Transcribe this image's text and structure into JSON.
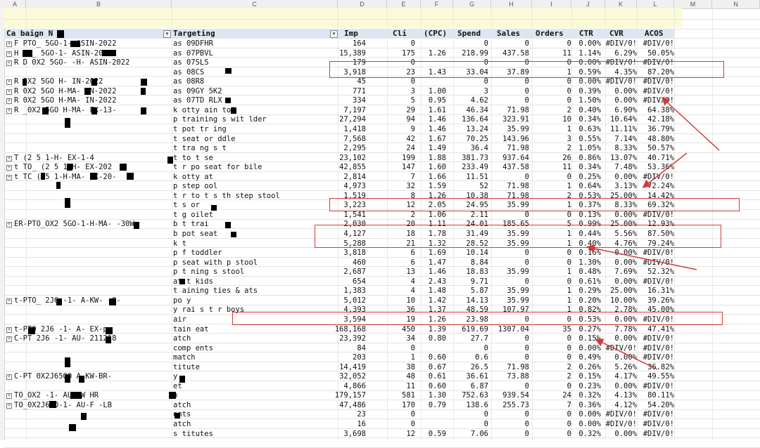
{
  "column_letters": [
    "A",
    "B",
    "C",
    "D",
    "E",
    "F",
    "G",
    "H",
    "I",
    "J",
    "K",
    "L",
    "M",
    "N"
  ],
  "headers": [
    "Ca   baign N",
    "Targeting",
    "Imp",
    "Cli",
    "(CPC)",
    "Spend",
    "Sales",
    "Orders",
    "CTR",
    "CVR",
    "ACOS"
  ],
  "rows": [
    {
      "campaign": "F   PTO_    5GO-1-     ASIN-2022",
      "targeting": "as     09DFHR",
      "imp": "164",
      "cli": "0",
      "cpc": "",
      "spend": "0",
      "sales": "0",
      "orders": "0",
      "ctr": "0.00%",
      "cvr": "#DIV/0!",
      "acos": "#DIV/0!"
    },
    {
      "campaign": "H    TO_    5GO-1-     ASIN-2022",
      "targeting": "as     07PBVL",
      "imp": "15,389",
      "cli": "175",
      "cpc": "1.26",
      "spend": "218.99",
      "sales": "437.58",
      "orders": "11",
      "ctr": "1.14%",
      "cvr": "6.29%",
      "acos": "50.05%"
    },
    {
      "campaign": "R    D  0X2  5GO-   -H-     ASIN-2022",
      "targeting": "as     07SLS",
      "imp": "179",
      "cli": "0",
      "cpc": "",
      "spend": "0",
      "sales": "0",
      "orders": "0",
      "ctr": "0.00%",
      "cvr": "#DIV/0!",
      "acos": "#DIV/0!"
    },
    {
      "campaign": "",
      "targeting": "as     08CS",
      "imp": "3,918",
      "cli": "23",
      "cpc": "1.43",
      "spend": "33.04",
      "sales": "37.89",
      "orders": "1",
      "ctr": "0.59%",
      "cvr": "4.35%",
      "acos": "87.20%"
    },
    {
      "campaign": "R    0X2  5GO   H-    IN-2022",
      "targeting": "as     08R8",
      "imp": "45",
      "cli": "0",
      "cpc": "",
      "spend": "0",
      "sales": "0",
      "orders": "0",
      "ctr": "0.00%",
      "cvr": "#DIV/0!",
      "acos": "#DIV/0!"
    },
    {
      "campaign": "R    0X2  5GO   H-MA-   IN-2022",
      "targeting": "as     09GY  5K2",
      "imp": "771",
      "cli": "3",
      "cpc": "1.00",
      "spend": "3",
      "sales": "0",
      "orders": "0",
      "ctr": "0.39%",
      "cvr": "0.00%",
      "acos": "#DIV/0!"
    },
    {
      "campaign": "R    0X2  5GO   H-MA-   IN-2022",
      "targeting": "as     07TD  RLX",
      "imp": "334",
      "cli": "5",
      "cpc": "0.95",
      "spend": "4.62",
      "sales": "0",
      "orders": "0",
      "ctr": "1.50%",
      "cvr": "0.00%",
      "acos": "#DIV/0!"
    },
    {
      "campaign": "R    _0X2  5GO   H-MA-   EX-13-",
      "targeting": "k   otty   ain   toi  ",
      "imp": "7,197",
      "cli": "29",
      "cpc": "1.61",
      "spend": "46.34",
      "sales": "71.98",
      "orders": "2",
      "ctr": "0.40%",
      "cvr": "6.90%",
      "acos": "64.38%"
    },
    {
      "campaign": "",
      "targeting": "p   training s   wit    lder",
      "imp": "27,294",
      "cli": "94",
      "cpc": "1.46",
      "spend": "136.64",
      "sales": "323.91",
      "orders": "10",
      "ctr": "0.34%",
      "cvr": "10.64%",
      "acos": "42.18%"
    },
    {
      "campaign": "",
      "targeting": "t    pot   tr  ing",
      "imp": "1,418",
      "cli": "9",
      "cpc": "1.46",
      "spend": "13.24",
      "sales": "35.99",
      "orders": "1",
      "ctr": "0.63%",
      "cvr": "11.11%",
      "acos": "36.79%"
    },
    {
      "campaign": "",
      "targeting": "t    seat   or   ddle",
      "imp": "7,568",
      "cli": "42",
      "cpc": "1.67",
      "spend": "70.25",
      "sales": "143.96",
      "orders": "3",
      "ctr": "0.55%",
      "cvr": "7.14%",
      "acos": "48.80%"
    },
    {
      "campaign": "",
      "targeting": "t    tra   ng s   t",
      "imp": "2,295",
      "cli": "24",
      "cpc": "1.49",
      "spend": "36.4",
      "sales": "71.98",
      "orders": "2",
      "ctr": "1.05%",
      "cvr": "8.33%",
      "acos": "50.57%"
    },
    {
      "campaign": "    T  (2  5   1-H-    EX-1-4",
      "targeting": "t    to   t se",
      "imp": "23,102",
      "cli": "199",
      "cpc": "1.88",
      "spend": "381.73",
      "sales": "937.64",
      "orders": "26",
      "ctr": "0.86%",
      "cvr": "13.07%",
      "acos": "40.71%"
    },
    {
      "campaign": "   t  TO_  (2  5   1-H-    EX-202",
      "targeting": "t   r po   seat  for  bile",
      "imp": "42,855",
      "cli": "147",
      "cpc": "1.60",
      "spend": "233.49",
      "sales": "437.58",
      "orders": "11",
      "ctr": "0.34%",
      "cvr": "7.48%",
      "acos": "53.36%"
    },
    {
      "campaign": "    t  TC   (  5   1-H-MA-   EX-20-",
      "targeting": "k   otty   at",
      "imp": "2,814",
      "cli": "7",
      "cpc": "1.66",
      "spend": "11.51",
      "sales": "0",
      "orders": "0",
      "ctr": "0.25%",
      "cvr": "0.00%",
      "acos": "#DIV/0!"
    },
    {
      "campaign": "",
      "targeting": "p    step   ool",
      "imp": "4,973",
      "cli": "32",
      "cpc": "1.59",
      "spend": "52",
      "sales": "71.98",
      "orders": "1",
      "ctr": "0.64%",
      "cvr": "3.13%",
      "acos": "72.24%"
    },
    {
      "campaign": "",
      "targeting": "t    r to   t s   th step stool",
      "imp": "1,519",
      "cli": "8",
      "cpc": "1.26",
      "spend": "10.38",
      "sales": "71.98",
      "orders": "2",
      "ctr": "0.53%",
      "cvr": "25.00%",
      "acos": "14.42%"
    },
    {
      "campaign": "",
      "targeting": "t   s    or  ",
      "imp": "3,223",
      "cli": "12",
      "cpc": "2.05",
      "spend": "24.95",
      "sales": "35.99",
      "orders": "1",
      "ctr": "0.37%",
      "cvr": "8.33%",
      "acos": "69.32%"
    },
    {
      "campaign": "",
      "targeting": "t    g  oilet",
      "imp": "1,541",
      "cli": "2",
      "cpc": "1.06",
      "spend": "2.11",
      "sales": "0",
      "orders": "0",
      "ctr": "0.13%",
      "cvr": "0.00%",
      "acos": "#DIV/0!"
    },
    {
      "campaign": "   ER-PTO_OX2  5GO-1-H-MA-    -30W",
      "targeting": "b    t  trai  ",
      "imp": "2,030",
      "cli": "20",
      "cpc": "1.11",
      "spend": "24.01",
      "sales": "185.65",
      "orders": "5",
      "ctr": "0.99%",
      "cvr": "25.00%",
      "acos": "12.93%"
    },
    {
      "campaign": "",
      "targeting": "b   pot   seat",
      "imp": "4,127",
      "cli": "18",
      "cpc": "1.78",
      "spend": "31.49",
      "sales": "35.99",
      "orders": "1",
      "ctr": "0.44%",
      "cvr": "5.56%",
      "acos": "87.50%"
    },
    {
      "campaign": "",
      "targeting": "k    t",
      "imp": "5,288",
      "cli": "21",
      "cpc": "1.32",
      "spend": "28.52",
      "sales": "35.99",
      "orders": "1",
      "ctr": "0.40%",
      "cvr": "4.76%",
      "acos": "79.24%"
    },
    {
      "campaign": "",
      "targeting": "p    f    toddler",
      "imp": "3,818",
      "cli": "6",
      "cpc": "1.69",
      "spend": "10.14",
      "sales": "0",
      "orders": "0",
      "ctr": "0.16%",
      "cvr": "0.00%",
      "acos": "#DIV/0!"
    },
    {
      "campaign": "",
      "targeting": "p    seat with   p stool",
      "imp": "460",
      "cli": "6",
      "cpc": "1.47",
      "spend": "8.84",
      "sales": "0",
      "orders": "0",
      "ctr": "1.30%",
      "cvr": "0.00%",
      "acos": "#DIV/0!"
    },
    {
      "campaign": "",
      "targeting": "p   t   ning s    stool",
      "imp": "2,687",
      "cli": "13",
      "cpc": "1.46",
      "spend": "18.83",
      "sales": "35.99",
      "orders": "1",
      "ctr": "0.48%",
      "cvr": "7.69%",
      "acos": "52.32%"
    },
    {
      "campaign": "",
      "targeting": "    at   t kids",
      "imp": "654",
      "cli": "4",
      "cpc": "2.43",
      "spend": "9.71",
      "sales": "0",
      "orders": "0",
      "ctr": "0.61%",
      "cvr": "0.00%",
      "acos": "#DIV/0!"
    },
    {
      "campaign": "",
      "targeting": "   t   aining   ties &   ats",
      "imp": "1,383",
      "cli": "4",
      "cpc": "1.48",
      "spend": "5.87",
      "sales": "35.99",
      "orders": "1",
      "ctr": "0.29%",
      "cvr": "25.00%",
      "acos": "16.31%"
    },
    {
      "campaign": "   t-PTO_   2J6    -1-   A-KW-   -8-",
      "targeting": "    po   y",
      "imp": "5,012",
      "cli": "10",
      "cpc": "1.42",
      "spend": "14.13",
      "sales": "35.99",
      "orders": "1",
      "ctr": "0.20%",
      "cvr": "10.00%",
      "acos": "39.26%"
    },
    {
      "campaign": "",
      "targeting": "    y  rai   s    t   r boys",
      "imp": "4,393",
      "cli": "36",
      "cpc": "1.37",
      "spend": "48.59",
      "sales": "107.97",
      "orders": "1",
      "ctr": "0.82%",
      "cvr": "2.78%",
      "acos": "45.00%"
    },
    {
      "campaign": "",
      "targeting": "         air",
      "imp": "3,594",
      "cli": "19",
      "cpc": "1.26",
      "spend": "23.98",
      "sales": "0",
      "orders": "0",
      "ctr": "0.53%",
      "cvr": "0.00%",
      "acos": "#DIV/0!"
    },
    {
      "campaign": "   t-PTO   2J6    -1-   A-    EX-po",
      "targeting": "       tain   eat",
      "imp": "168,168",
      "cli": "450",
      "cpc": "1.39",
      "spend": "619.69",
      "sales": "1307.04",
      "orders": "35",
      "ctr": "0.27%",
      "cvr": "7.78%",
      "acos": "47.41%"
    },
    {
      "campaign": "  C-PT    2J6    -1-   AU-   211218",
      "targeting": "     atch",
      "imp": "23,392",
      "cli": "34",
      "cpc": "0.80",
      "spend": "27.7",
      "sales": "0",
      "orders": "0",
      "ctr": "0.15%",
      "cvr": "0.00%",
      "acos": "#DIV/0!"
    },
    {
      "campaign": "",
      "targeting": "comp    ents",
      "imp": "84",
      "cli": "0",
      "cpc": "",
      "spend": "0",
      "sales": "0",
      "orders": "0",
      "ctr": "0.00%",
      "cvr": "#DIV/0!",
      "acos": "#DIV/0!"
    },
    {
      "campaign": "",
      "targeting": "     match",
      "imp": "203",
      "cli": "1",
      "cpc": "0.60",
      "spend": "0.6",
      "sales": "0",
      "orders": "0",
      "ctr": "0.49%",
      "cvr": "0.00%",
      "acos": "#DIV/0!"
    },
    {
      "campaign": "",
      "targeting": "   titute",
      "imp": "14,419",
      "cli": "38",
      "cpc": "0.67",
      "spend": "26.5",
      "sales": "71.98",
      "orders": "2",
      "ctr": "0.26%",
      "cvr": "5.26%",
      "acos": "36.82%"
    },
    {
      "campaign": "  C-PT   0X2J65GO     A-KW-BR-",
      "targeting": "     y",
      "imp": "32,052",
      "cli": "48",
      "cpc": "0.61",
      "spend": "36.61",
      "sales": "73.88",
      "orders": "2",
      "ctr": "0.15%",
      "cvr": "4.17%",
      "acos": "49.55%"
    },
    {
      "campaign": "",
      "targeting": "    et  ",
      "imp": "4,866",
      "cli": "11",
      "cpc": "0.60",
      "spend": "6.87",
      "sales": "0",
      "orders": "0",
      "ctr": "0.23%",
      "cvr": "0.00%",
      "acos": "#DIV/0!"
    },
    {
      "campaign": "     TO_OX2    -1-   AU-KW   HR",
      "targeting": "     h",
      "imp": "179,157",
      "cli": "581",
      "cpc": "1.30",
      "spend": "752.63",
      "sales": "939.54",
      "orders": "24",
      "ctr": "0.32%",
      "cvr": "4.13%",
      "acos": "80.11%"
    },
    {
      "campaign": "    TO_0X2J6GO-1-   AU-F   -LB",
      "targeting": "     atch",
      "imp": "47,486",
      "cli": "170",
      "cpc": "0.79",
      "spend": "138.6",
      "sales": "255.73",
      "orders": "7",
      "ctr": "0.36%",
      "cvr": "4.12%",
      "acos": "54.20%"
    },
    {
      "campaign": "",
      "targeting": "    ents",
      "imp": "23",
      "cli": "0",
      "cpc": "",
      "spend": "0",
      "sales": "0",
      "orders": "0",
      "ctr": "0.00%",
      "cvr": "#DIV/0!",
      "acos": "#DIV/0!"
    },
    {
      "campaign": "",
      "targeting": "    atch",
      "imp": "16",
      "cli": "0",
      "cpc": "",
      "spend": "0",
      "sales": "0",
      "orders": "0",
      "ctr": "0.00%",
      "cvr": "#DIV/0!",
      "acos": "#DIV/0!"
    },
    {
      "campaign": "",
      "targeting": "s   titutes",
      "imp": "3,698",
      "cli": "12",
      "cpc": "0.59",
      "spend": "7.06",
      "sales": "0",
      "orders": "0",
      "ctr": "0.32%",
      "cvr": "0.00%",
      "acos": "#DIV/0!"
    }
  ],
  "colors": {
    "highlight": "#d43b3b",
    "header_band": "#dde6f2",
    "yellow_band": "#fbfbd9"
  }
}
